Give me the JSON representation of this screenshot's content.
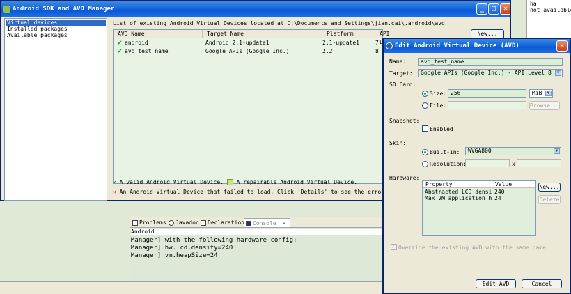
{
  "ide": {
    "right_panel_lines": [
      "ha",
      "not available."
    ],
    "console_tabs": [
      {
        "label": "Problems"
      },
      {
        "label": "Javadoc"
      },
      {
        "label": "Declaration"
      },
      {
        "label": "Console"
      }
    ],
    "console_header": "Android",
    "console_lines": [
      "Manager] with the following hardware config:",
      "Manager] hw.lcd.density=240",
      "Manager] vm.heapSize=24"
    ]
  },
  "sdk_window": {
    "title": "Android SDK and AVD Manager",
    "title_buttons": {
      "minimize": "_",
      "maximize": "□",
      "close": "✕"
    },
    "nav_items": [
      {
        "label": "Virtual devices",
        "selected": true
      },
      {
        "label": "Installed packages",
        "selected": false
      },
      {
        "label": "Available packages",
        "selected": false
      }
    ],
    "list_caption": "List of existing Android Virtual Devices located at C:\\Documents and Settings\\jian.cai\\.android\\avd",
    "columns": [
      "AVD Name",
      "Target Name",
      "Platform",
      "API Level"
    ],
    "rows": [
      {
        "name": "android",
        "target": "Android 2.1-update1",
        "platform": "2.1-update1",
        "api": "7"
      },
      {
        "name": "avd_test_name",
        "target": "Google APIs (Google Inc.)",
        "platform": "2.2",
        "api": "8"
      }
    ],
    "new_button": "New...",
    "legend": {
      "valid": "A valid Android Virtual Device.",
      "repairable": "A repairable Android Virtual Device.",
      "failed": "An Android Virtual Device that failed to load. Click 'Details' to see the error."
    }
  },
  "dialog": {
    "title": "Edit Android Virtual Device (AVD)",
    "close_glyph": "✕",
    "name_label": "Name:",
    "name_value": "avd_test_name",
    "target_label": "Target:",
    "target_value": "Google APIs (Google Inc.) - API Level 8",
    "sdcard_label": "SD Card:",
    "size_label": "Size:",
    "size_value": "256",
    "size_unit": "MiB",
    "file_label": "File:",
    "browse_button": "Browse...",
    "snapshot_label": "Snapshot:",
    "enabled_label": "Enabled",
    "skin_label": "Skin:",
    "builtin_label": "Built-in:",
    "builtin_value": "WVGA800",
    "resolution_label": "Resolution:",
    "x_label": "x",
    "hardware_label": "Hardware:",
    "hw_columns": [
      "Property",
      "Value"
    ],
    "hw_rows": [
      {
        "property": "Abstracted LCD density",
        "value": "240"
      },
      {
        "property": "Max VM application h...",
        "value": "24"
      }
    ],
    "hw_new_button": "New...",
    "hw_delete_button": "Delete",
    "override_label": "Override the existing AVD with the same name",
    "edit_button": "Edit AVD",
    "cancel_button": "Cancel"
  }
}
